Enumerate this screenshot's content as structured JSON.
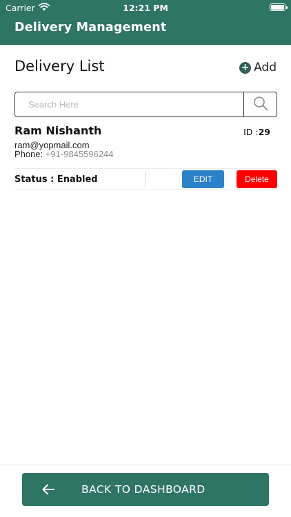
{
  "statusbar": {
    "carrier": "Carrier",
    "time": "12:21 PM"
  },
  "header": {
    "title": "Delivery Management"
  },
  "list": {
    "title": "Delivery List",
    "add_label": "Add"
  },
  "search": {
    "placeholder": "Search Here",
    "value": ""
  },
  "delivery": {
    "name": "Ram Nishanth",
    "id_label": "ID :",
    "id_value": "29",
    "email": "ram@yopmail.com",
    "phone_label": "Phone:",
    "phone_value": "+91-9845596244",
    "status_text": "Status : Enabled",
    "edit_label": "EDIT",
    "delete_label": "Delete"
  },
  "footer": {
    "back_label": "BACK TO DASHBOARD"
  },
  "icons": {
    "wifi": "wifi-icon",
    "battery": "battery-icon",
    "add": "plus-circle-icon",
    "search": "search-icon",
    "back": "arrow-left-icon"
  },
  "colors": {
    "primary": "#2f7566",
    "edit": "#2b82c9",
    "delete": "#ff0000"
  }
}
